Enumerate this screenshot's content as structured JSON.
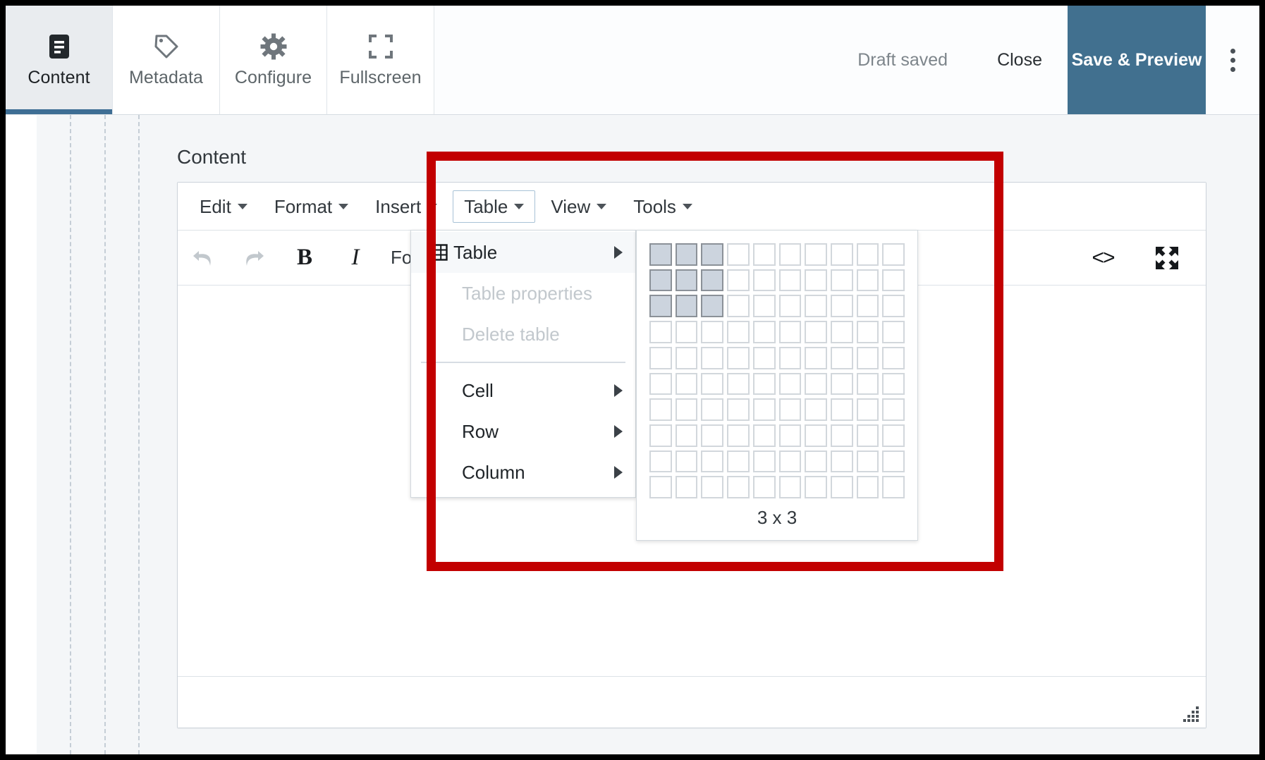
{
  "topbar": {
    "tabs": [
      {
        "label": "Content",
        "icon": "document-icon",
        "active": true
      },
      {
        "label": "Metadata",
        "icon": "tag-icon",
        "active": false
      },
      {
        "label": "Configure",
        "icon": "gear-icon",
        "active": false
      },
      {
        "label": "Fullscreen",
        "icon": "fullscreen-icon",
        "active": false
      }
    ],
    "status_text": "Draft saved",
    "close_label": "Close",
    "save_preview_label": "Save & Preview",
    "kebab_icon": "more-vertical-icon",
    "accent_color": "#41708f"
  },
  "page": {
    "field_label": "Content"
  },
  "editor": {
    "menubar": [
      {
        "label": "Edit",
        "open": false
      },
      {
        "label": "Format",
        "open": false
      },
      {
        "label": "Insert",
        "open": false
      },
      {
        "label": "Table",
        "open": true
      },
      {
        "label": "View",
        "open": false
      },
      {
        "label": "Tools",
        "open": false
      }
    ],
    "toolbar": {
      "undo_icon": "undo-icon",
      "redo_icon": "redo-icon",
      "bold_label": "B",
      "italic_label": "I",
      "format_label": "For",
      "source_code_label": "<>",
      "fullscreen_icon": "fullscreen-expand-icon",
      "resize_icon": "resize-grip-icon"
    }
  },
  "table_menu": {
    "items": [
      {
        "label": "Table",
        "icon": "table-grid-icon",
        "submenu": true,
        "disabled": false,
        "highlighted": true
      },
      {
        "label": "Table properties",
        "icon": "",
        "submenu": false,
        "disabled": true,
        "highlighted": false
      },
      {
        "label": "Delete table",
        "icon": "",
        "submenu": false,
        "disabled": true,
        "highlighted": false
      },
      {
        "separator": true
      },
      {
        "label": "Cell",
        "icon": "",
        "submenu": true,
        "disabled": false,
        "highlighted": false
      },
      {
        "label": "Row",
        "icon": "",
        "submenu": true,
        "disabled": false,
        "highlighted": false
      },
      {
        "label": "Column",
        "icon": "",
        "submenu": true,
        "disabled": false,
        "highlighted": false
      }
    ]
  },
  "grid_picker": {
    "columns": 10,
    "rows": 10,
    "selected_cols": 3,
    "selected_rows": 3,
    "size_label": "3 x 3",
    "selected_color": "#ccd4de",
    "cell_border_color": "#d2d7dc"
  },
  "annotation": {
    "color": "#c20000",
    "shape": "rectangle"
  }
}
